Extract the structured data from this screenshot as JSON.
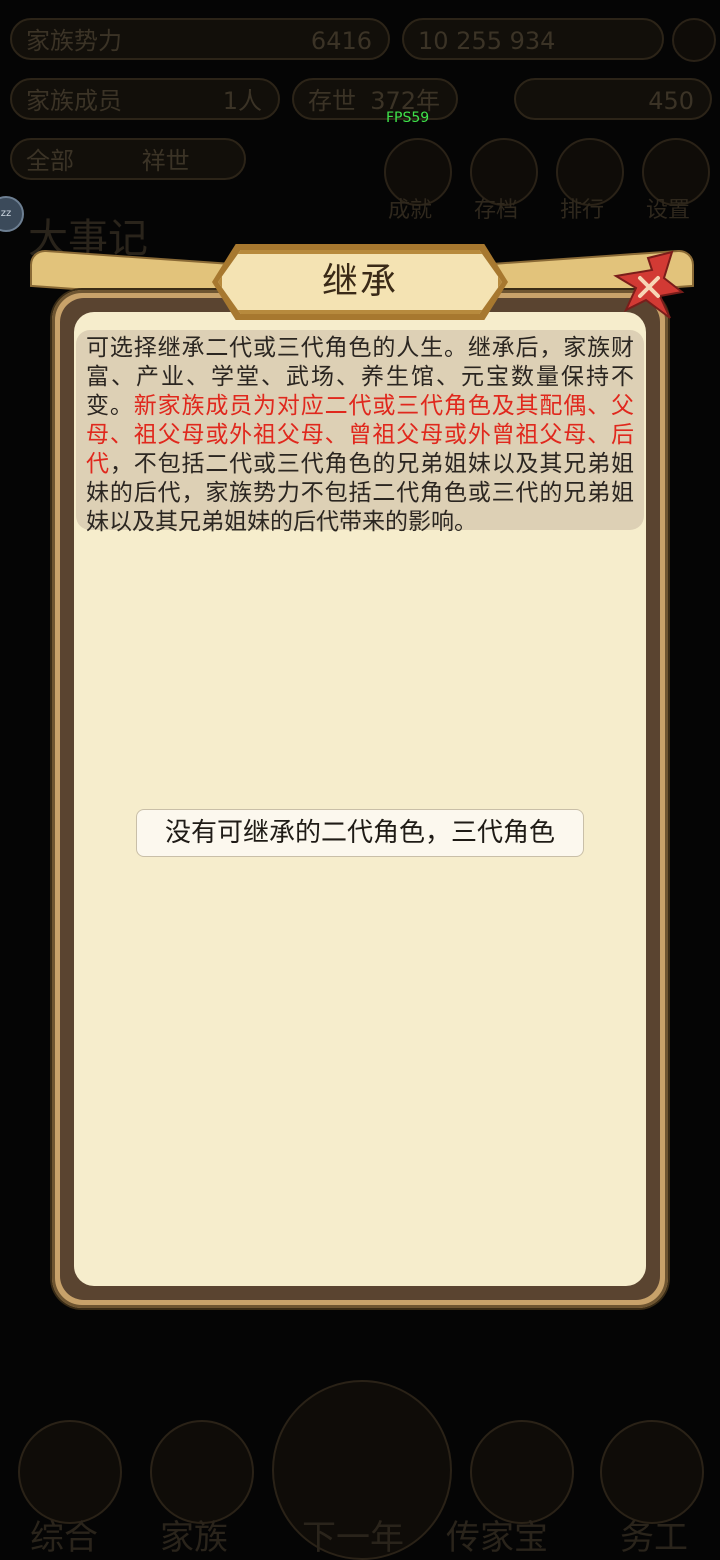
{
  "background": {
    "stats": [
      {
        "label": "家族势力",
        "value": "6416"
      },
      {
        "label": "家族成员",
        "value": "1人"
      },
      {
        "label": "存世",
        "value": "372年"
      }
    ],
    "resources": {
      "top": "10 255 934",
      "coins": "450"
    },
    "filters": [
      "全部",
      "祥世"
    ],
    "menu_icons": [
      "成就",
      "存档",
      "排行",
      "设置"
    ],
    "section_title": "大事记",
    "bottom_nav": [
      "综合",
      "家族",
      "下一年",
      "传家宝",
      "务工"
    ]
  },
  "fps": "FPS59",
  "badge": "zz",
  "dialog": {
    "title": "继承",
    "description_normal_1": "可选择继承二代或三代角色的人生。继承后，家族财富、产业、学堂、武场、养生馆、元宝数量保持不变。",
    "description_red": "新家族成员为对应二代或三代角色及其配偶、父母、祖父母或外祖父母、曾祖父母或外曾祖父母、后代",
    "description_normal_2": "，不包括二代或三代角色的兄弟姐妹以及其兄弟姐妹的后代，家族势力不包括二代角色或三代的兄弟姐妹以及其兄弟姐妹的后代带来的影响。",
    "empty_message": "没有可继承的二代角色，三代角色"
  },
  "colors": {
    "highlight": "#e0281d",
    "paper": "#f6edcc",
    "frame": "#c8a26a"
  }
}
